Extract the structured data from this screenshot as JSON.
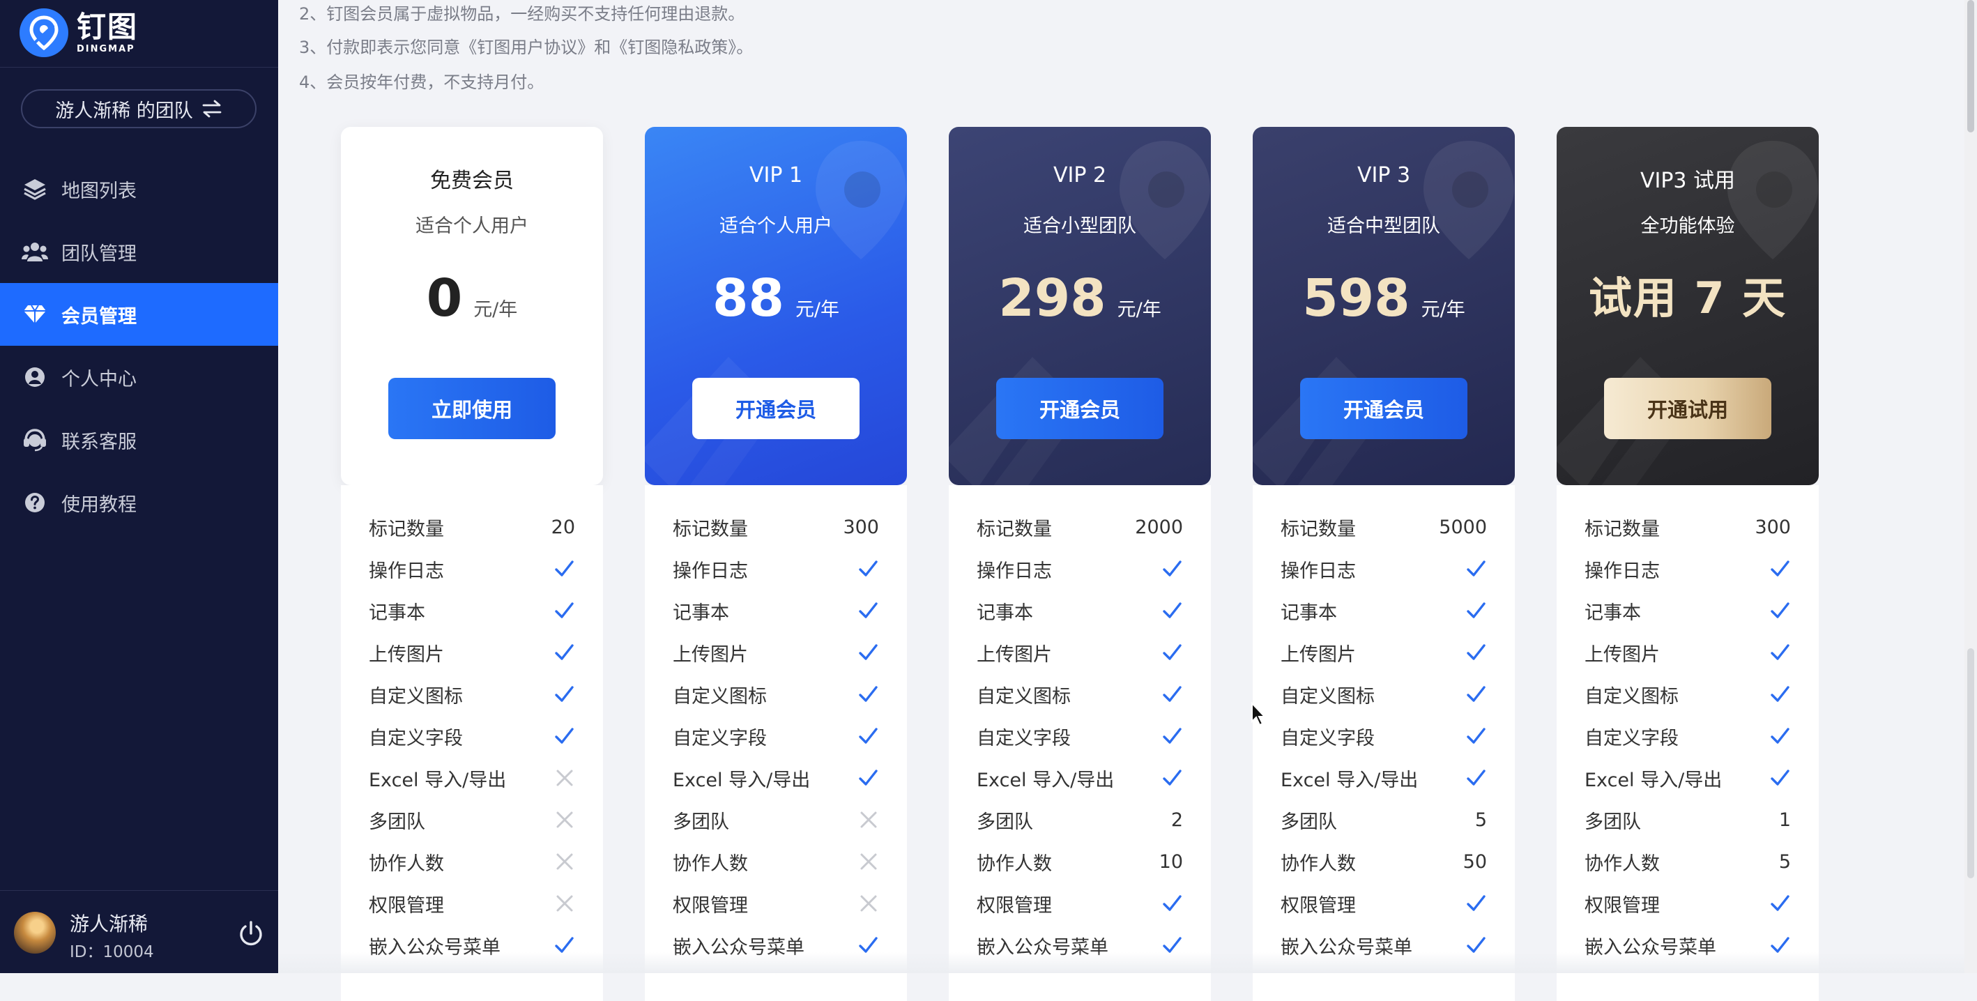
{
  "brand": {
    "name_cn": "钉图",
    "name_en": "DINGMAP",
    "logo_icon": "map-pin-logo-icon",
    "color": "#2d7cff"
  },
  "sidebar": {
    "team_button": {
      "label": "游人渐稀 的团队",
      "icon": "swap-arrows-icon"
    },
    "items": [
      {
        "label": "地图列表",
        "icon": "layers-icon",
        "active": false
      },
      {
        "label": "团队管理",
        "icon": "team-icon",
        "active": false
      },
      {
        "label": "会员管理",
        "icon": "diamond-icon",
        "active": true
      },
      {
        "label": "个人中心",
        "icon": "user-circle-icon",
        "active": false
      },
      {
        "label": "联系客服",
        "icon": "headset-icon",
        "active": false
      },
      {
        "label": "使用教程",
        "icon": "help-circle-icon",
        "active": false
      }
    ],
    "active_color": "#1e6bff",
    "background": "#131838",
    "user": {
      "name": "游人渐稀",
      "id": "ID：10004",
      "logout_icon": "power-icon"
    }
  },
  "notes": [
    "2、钉图会员属于虚拟物品，一经购买不支持任何理由退款。",
    "3、付款即表示您同意《钉图用户协议》和《钉图隐私政策》。",
    "4、会员按年付费，不支持月付。"
  ],
  "feature_labels": [
    "标记数量",
    "操作日志",
    "记事本",
    "上传图片",
    "自定义图标",
    "自定义字段",
    "Excel 导入/导出",
    "多团队",
    "协作人数",
    "权限管理",
    "嵌入公众号菜单"
  ],
  "plans": [
    {
      "name": "免费会员",
      "subtitle": "适合个人用户",
      "price": "0",
      "unit": "元/年",
      "button": "立即使用",
      "features": [
        "20",
        "check",
        "check",
        "check",
        "check",
        "check",
        "cross",
        "cross",
        "cross",
        "cross",
        "check"
      ]
    },
    {
      "name": "VIP 1",
      "subtitle": "适合个人用户",
      "price": "88",
      "unit": "元/年",
      "button": "开通会员",
      "features": [
        "300",
        "check",
        "check",
        "check",
        "check",
        "check",
        "check",
        "cross",
        "cross",
        "cross",
        "check"
      ]
    },
    {
      "name": "VIP 2",
      "subtitle": "适合小型团队",
      "price": "298",
      "unit": "元/年",
      "button": "开通会员",
      "features": [
        "2000",
        "check",
        "check",
        "check",
        "check",
        "check",
        "check",
        "2",
        "10",
        "check",
        "check"
      ]
    },
    {
      "name": "VIP 3",
      "subtitle": "适合中型团队",
      "price": "598",
      "unit": "元/年",
      "button": "开通会员",
      "features": [
        "5000",
        "check",
        "check",
        "check",
        "check",
        "check",
        "check",
        "5",
        "50",
        "check",
        "check"
      ]
    },
    {
      "name": "VIP3 试用",
      "subtitle": "全功能体验",
      "price_text": "试用 7 天",
      "button": "开通试用",
      "features": [
        "300",
        "check",
        "check",
        "check",
        "check",
        "check",
        "check",
        "1",
        "5",
        "check",
        "check"
      ]
    }
  ],
  "colors": {
    "check": "#2a6cf0",
    "cross": "#c8cad0",
    "price_gold": "#f3e3c2"
  }
}
